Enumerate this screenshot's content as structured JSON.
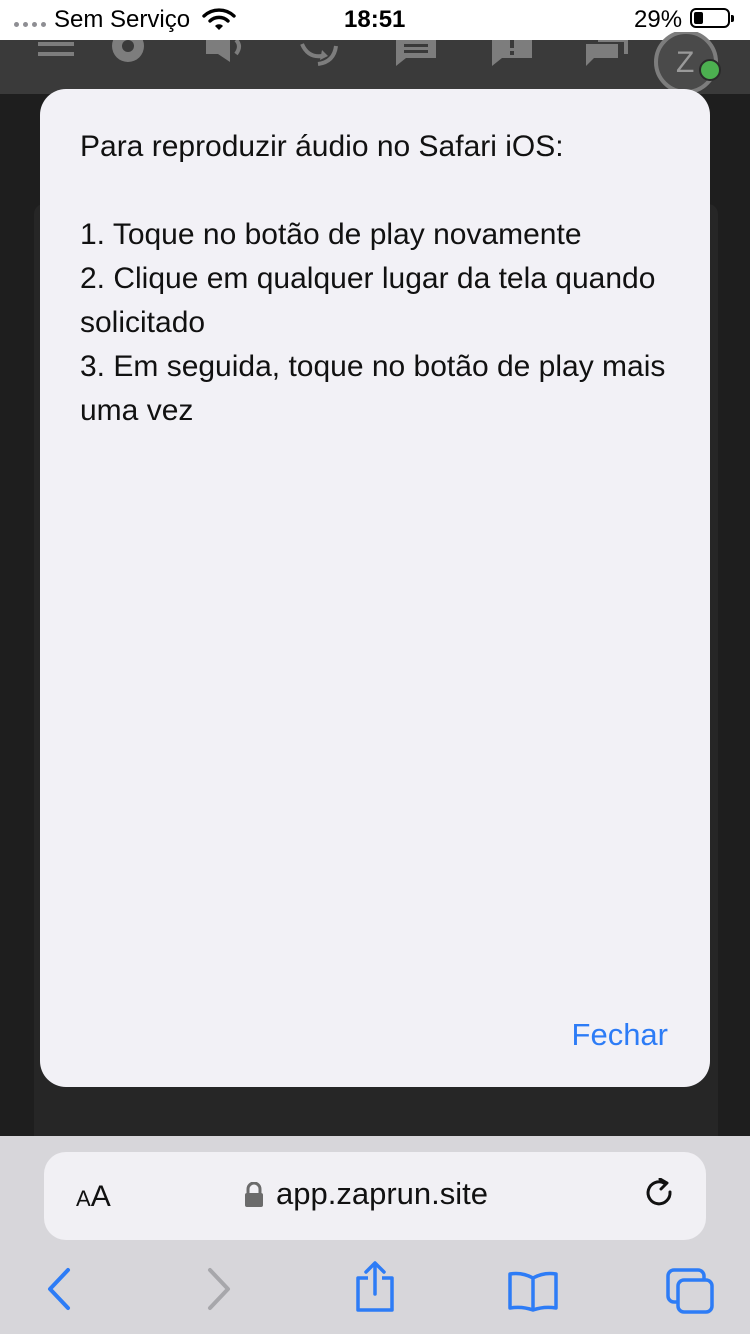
{
  "status_bar": {
    "carrier": "Sem Serviço",
    "time": "18:51",
    "battery_percent": "29%",
    "battery_level": 0.29
  },
  "app_toolbar": {
    "icons": [
      "menu-icon",
      "gear-icon",
      "speaker-icon",
      "sync-icon",
      "chat-icon",
      "alert-icon",
      "conversation-icon",
      "avatar-icon"
    ]
  },
  "modal": {
    "heading": "Para reproduzir áudio no Safari iOS:",
    "steps": [
      "1. Toque no botão de play novamente",
      "2. Clique em qualquer lugar da tela quando solicitado",
      "3. Em seguida, toque no botão de play mais uma vez"
    ],
    "close_label": "Fechar"
  },
  "safari": {
    "text_size_small": "A",
    "text_size_big": "A",
    "url": "app.zaprun.site"
  },
  "colors": {
    "accent": "#2d7cf6",
    "modal_bg": "#f2f1f6",
    "safari_bar_bg": "#d7d6da",
    "status_dot": "#4caf50"
  }
}
